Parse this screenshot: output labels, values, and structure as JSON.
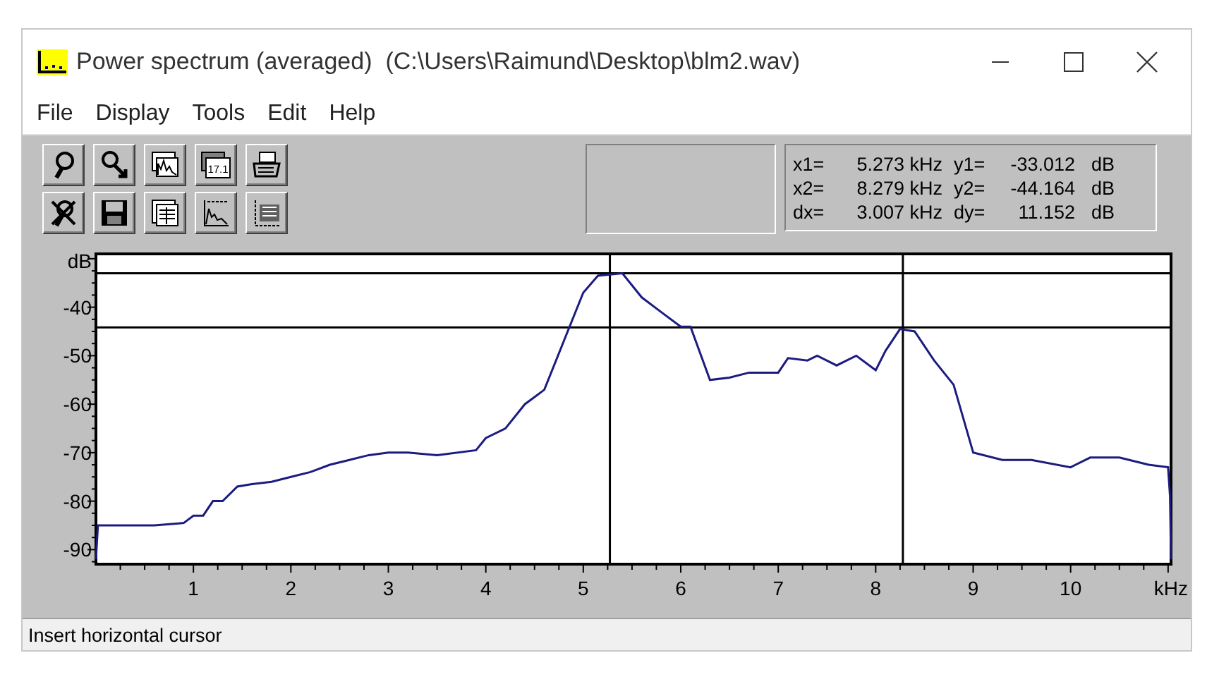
{
  "window": {
    "title": "Power spectrum (averaged)  (C:\\Users\\Raimund\\Desktop\\blm2.wav)"
  },
  "menu": [
    "File",
    "Display",
    "Tools",
    "Edit",
    "Help"
  ],
  "toolbar": [
    {
      "kind": "magnifier"
    },
    {
      "kind": "zoom"
    },
    {
      "kind": "spectrum-window"
    },
    {
      "kind": "number-window",
      "label": "17.1"
    },
    {
      "kind": "printer"
    },
    {
      "kind": "crossed-magnifier"
    },
    {
      "kind": "floppy"
    },
    {
      "kind": "table"
    },
    {
      "kind": "spectrum"
    },
    {
      "kind": "grid"
    }
  ],
  "readout": [
    {
      "x_label": "x1=",
      "x_value": "5.273 kHz",
      "y_label": "y1=",
      "y_value": "-33.012",
      "y_unit": "dB"
    },
    {
      "x_label": "x2=",
      "x_value": "8.279 kHz",
      "y_label": "y2=",
      "y_value": "-44.164",
      "y_unit": "dB"
    },
    {
      "x_label": "dx=",
      "x_value": "3.007 kHz",
      "y_label": "dy=",
      "y_value": "11.152",
      "y_unit": "dB"
    }
  ],
  "chart_data": {
    "type": "line",
    "xlabel": "kHz",
    "ylabel": "dB",
    "xlim": [
      0,
      11.03
    ],
    "ylim": [
      -93,
      -29
    ],
    "xticks": [
      1,
      2,
      3,
      4,
      5,
      6,
      7,
      8,
      9,
      10
    ],
    "yticks": [
      -40,
      -50,
      -60,
      -70,
      -80,
      -90
    ],
    "x": [
      0,
      0.02,
      0.6,
      0.9,
      1.0,
      1.1,
      1.2,
      1.3,
      1.45,
      1.6,
      1.8,
      2.0,
      2.2,
      2.4,
      2.6,
      2.8,
      3.0,
      3.2,
      3.5,
      3.9,
      4.0,
      4.2,
      4.4,
      4.6,
      4.8,
      5.0,
      5.15,
      5.4,
      5.6,
      5.8,
      6.0,
      6.1,
      6.3,
      6.5,
      6.7,
      7.0,
      7.1,
      7.3,
      7.4,
      7.6,
      7.8,
      8.0,
      8.1,
      8.25,
      8.4,
      8.6,
      8.8,
      9.0,
      9.3,
      9.6,
      10.0,
      10.2,
      10.5,
      10.8,
      11.0,
      11.02,
      11.03
    ],
    "series": [
      {
        "color": "#1c1c80",
        "values": [
          -92,
          -85,
          -85,
          -84.5,
          -83,
          -83,
          -80,
          -80,
          -77,
          -76.5,
          -76,
          -75,
          -74,
          -72.5,
          -71.5,
          -70.5,
          -70,
          -70,
          -70.5,
          -69.5,
          -67,
          -65,
          -60,
          -57,
          -47,
          -37,
          -33.5,
          -33,
          -38,
          -41,
          -44,
          -44,
          -55,
          -54.5,
          -53.5,
          -53.5,
          -50.5,
          -51,
          -50,
          -52,
          -50,
          -53,
          -49,
          -44.5,
          -45,
          -51,
          -56,
          -70,
          -71.5,
          -71.5,
          -73,
          -71,
          -71,
          -72.5,
          -73,
          -79,
          -92
        ]
      }
    ],
    "ref_lines": [
      {
        "axis": "x",
        "value": 5.273
      },
      {
        "axis": "x",
        "value": 8.279
      },
      {
        "axis": "y",
        "value": -33.012
      },
      {
        "axis": "y",
        "value": -44.164
      }
    ]
  },
  "status_bar": "Insert horizontal cursor"
}
